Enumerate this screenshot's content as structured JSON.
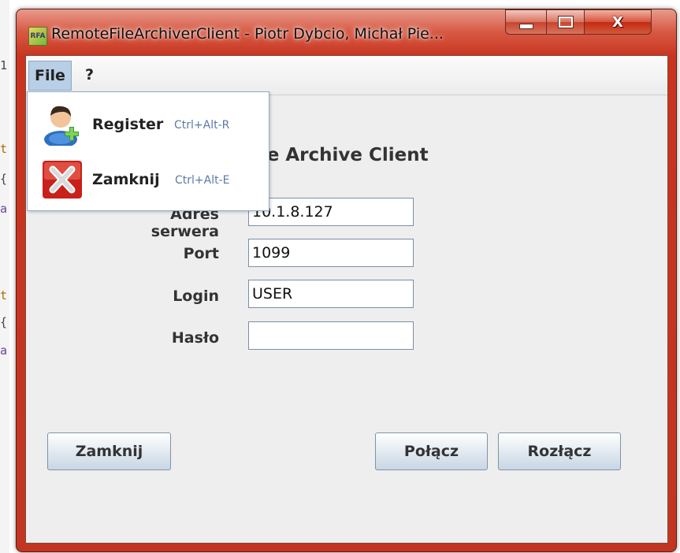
{
  "window": {
    "title": "RemoteFileArchiverClient - Piotr Dybcio, Michał Pie...",
    "icon_text": "RFA",
    "controls": {
      "minimize_icon": "minimize-icon",
      "maximize_icon": "maximize-icon",
      "close_icon": "close-icon"
    }
  },
  "menubar": {
    "items": [
      {
        "label": "File",
        "active": true
      },
      {
        "label": "?"
      }
    ]
  },
  "file_menu": {
    "items": [
      {
        "label": "Register",
        "shortcut": "Ctrl+Alt-R",
        "icon": "add-user-icon"
      },
      {
        "label": "Zamknij",
        "shortcut": "Ctrl+Alt-E",
        "icon": "close-x-icon"
      }
    ]
  },
  "form": {
    "title_visible": "ile Archive Client",
    "labels": {
      "server": "Adres serwera",
      "port": "Port",
      "login": "Login",
      "password": "Hasło"
    },
    "values": {
      "server": "10.1.8.127",
      "port": "1099",
      "login": "USER",
      "password": ""
    }
  },
  "buttons": {
    "close": "Zamknij",
    "connect": "Połącz",
    "disconnect": "Rozłącz"
  },
  "colors": {
    "frame": "#c8341f",
    "menu_highlight": "#b8cfe5",
    "client_bg": "#eeeeee",
    "shortcut": "#5a7aa8"
  },
  "background_code": [
    "1",
    "t",
    "{",
    "a",
    "t",
    "{",
    "a"
  ]
}
